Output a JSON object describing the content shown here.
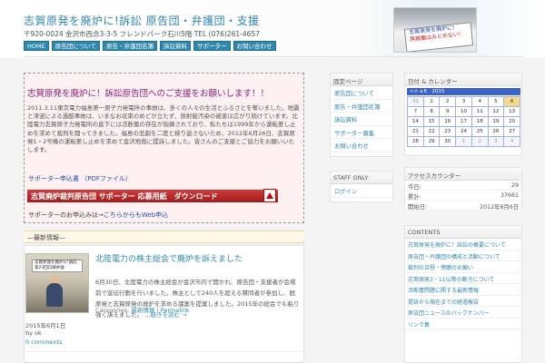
{
  "header": {
    "title": "志賀原発を廃炉に!訴訟 原告団・弁護団・支援",
    "address": "〒920-0024 金沢市西念3-3-5 フレンドパーク石川5階 TEL (076)261-4657",
    "photo_text_line1": "志賀原発を廃炉に!",
    "photo_text_line2": "再稼働はみとめない!"
  },
  "nav": [
    "HOME",
    "原告団について",
    "原告・弁護団名簿",
    "訴訟資料",
    "サポーター",
    "お問い合わせ"
  ],
  "feature": {
    "title": "志賀原発を廃炉に！訴訟原告団へのご支援をお願いします！！",
    "body": "2011.3.11東京電力福島第一原子力発電所の事故は、多くの人々の生活とふるさとを奪いました。地震と津波による過酷事故は、いまなお収束のめどが立たず、放射能汚染の被害は広がり続けています。北陸電力志賀原子力発電所の直下には活断層の存在が指摘されており、私たちは1999年から運転差し止めを求めて裁判を闘ってきました。福島の悲劇を二度と繰り返さないため、2012年6月26日、志賀原発1・2号機の運転差し止めを求めて金沢地裁に提訴しました。皆さんのご支援とご協力をお願いいたします。",
    "link1": "サポーター申込書 （PDFファイル）",
    "support_bar": "志賀廃炉裁判原告団 サポーター 応募用紙　ダウンロード",
    "link2_prefix": "サポーターのお申込みは→",
    "link2": "こちらからもWeb申込"
  },
  "section": {
    "title": "—最新情報—"
  },
  "post": {
    "title": "北陸電力の株主総会で廃炉を訴えました",
    "excerpt": "6月30日、北陸電力の株主総会が金沢市内で開かれ、原告団・支援者が会場前で宣伝行動を行いました。株主として240人を超える賛同者が参加し、脱原発と志賀原発の廃炉を求める議案を提案しました。2015年の総会でも粘り強く訴えました。 …",
    "more": "続きを読む →",
    "categories_label": "Categories:",
    "category": "最新情報",
    "permalink": "Permalink",
    "date": "2015年6月1日",
    "by": "by ok",
    "comments": "0 comments",
    "thumb_banner": "志賀原発を廃炉に!訴訟 第23回口頭弁論"
  },
  "sidebar_pages": {
    "title": "固定ページ",
    "items": [
      "原告団について",
      "原告・弁護団名簿",
      "訴訟資料",
      "サポーター募集",
      "お問い合わせ"
    ]
  },
  "staff": {
    "title": "STAFF ONLY",
    "items": [
      "ログイン"
    ]
  },
  "calendar": {
    "title": "日付 & カレンダー",
    "nav": "<< ◂ 6　2015",
    "cells": [
      {
        "d": "31",
        "dim": true
      },
      {
        "d": "1"
      },
      {
        "d": "2"
      },
      {
        "d": "3"
      },
      {
        "d": "4"
      },
      {
        "d": "5"
      },
      {
        "d": "6",
        "today": true
      },
      {
        "d": "7"
      },
      {
        "d": "8"
      },
      {
        "d": "9"
      },
      {
        "d": "10"
      },
      {
        "d": "11"
      },
      {
        "d": "12"
      },
      {
        "d": "13"
      },
      {
        "d": "14"
      },
      {
        "d": "15"
      },
      {
        "d": "16"
      },
      {
        "d": "17"
      },
      {
        "d": "18"
      },
      {
        "d": "19"
      },
      {
        "d": "20"
      },
      {
        "d": "21"
      },
      {
        "d": "22"
      },
      {
        "d": "23"
      },
      {
        "d": "24"
      },
      {
        "d": "25"
      },
      {
        "d": "26"
      },
      {
        "d": "27"
      },
      {
        "d": "28"
      },
      {
        "d": "29"
      },
      {
        "d": "30"
      },
      {
        "d": "1",
        "dim": true
      },
      {
        "d": "2",
        "dim": true
      },
      {
        "d": "3",
        "dim": true
      },
      {
        "d": "4",
        "dim": true
      }
    ]
  },
  "stats": {
    "title": "アクセスカウンター",
    "rows": [
      {
        "k": "今日:",
        "v": "29"
      },
      {
        "k": "累計:",
        "v": "37661"
      },
      {
        "k": "開始日:",
        "v": "2012年8月6日"
      }
    ]
  },
  "contents": {
    "title": "CONTENTS",
    "items": [
      "志賀原発を廃炉に！訴訟の概要について",
      "原告団・弁護団の構成と活動について",
      "裁判の日程・傍聴のお願い",
      "志賀原発3・11以降の動きについて",
      "活断層問題に関する最新情報",
      "提訴から現在までの経過報告",
      "原告団ニュースのバックナンバー",
      "リンク集"
    ]
  }
}
